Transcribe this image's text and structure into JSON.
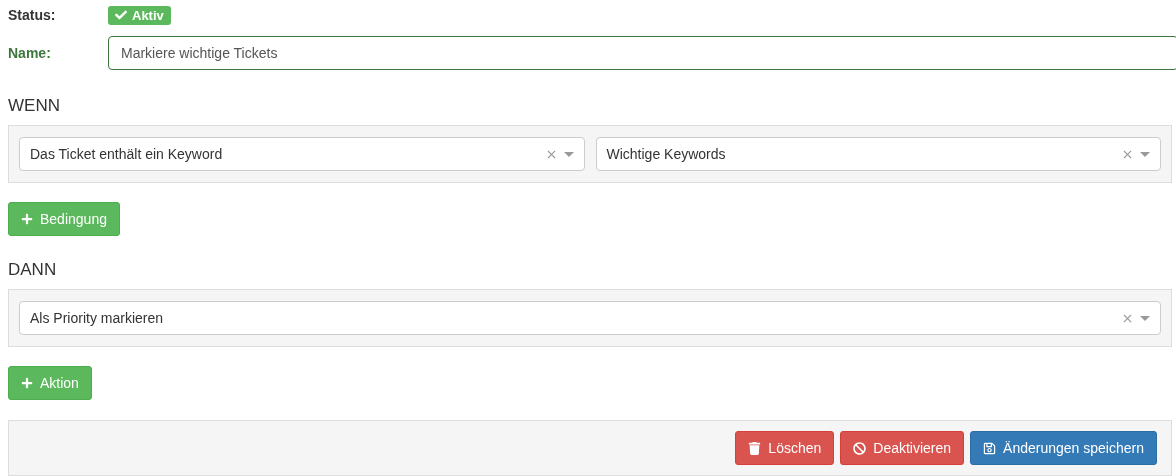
{
  "status": {
    "label": "Status:",
    "badge": "Aktiv",
    "active": true
  },
  "name": {
    "label": "Name:",
    "value": "Markiere wichtige Tickets",
    "valid": true
  },
  "sections": [
    {
      "heading": "WENN",
      "selects": [
        {
          "value": "Das Ticket enthält ein Keyword"
        },
        {
          "value": "Wichtige Keywords"
        }
      ],
      "add_button": "Bedingung"
    },
    {
      "heading": "DANN",
      "selects": [
        {
          "value": "Als Priority markieren"
        }
      ],
      "add_button": "Aktion"
    }
  ],
  "footer_buttons": [
    {
      "kind": "delete",
      "label": "Löschen"
    },
    {
      "kind": "deactivate",
      "label": "Deaktivieren"
    },
    {
      "kind": "save",
      "label": "Änderungen speichern"
    }
  ]
}
